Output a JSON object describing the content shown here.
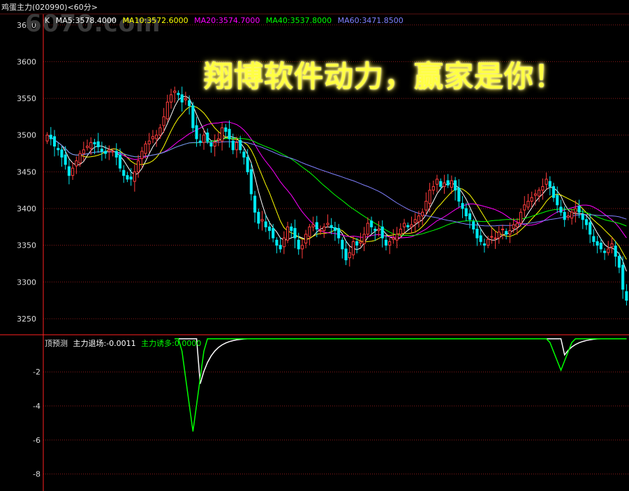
{
  "header": {
    "title": "鸡蛋主力(020990)<60分>",
    "watermark": "6070.com",
    "slogan": "翔博软件动力，赢家是你！"
  },
  "legend": [
    {
      "label": "K",
      "color": "#e0e0e0"
    },
    {
      "label": "MA5:3578.4000",
      "color": "#ffffff"
    },
    {
      "label": "MA10:3572.6000",
      "color": "#ffff00"
    },
    {
      "label": "MA20:3574.7000",
      "color": "#ff00ff"
    },
    {
      "label": "MA40:3537.8000",
      "color": "#00ff00"
    },
    {
      "label": "MA60:3471.8500",
      "color": "#8080ff"
    }
  ],
  "indicator_legend": [
    {
      "label": "顶预测",
      "color": "#e0e0e0"
    },
    {
      "label": "主力退场:-0.0011",
      "color": "#ffffff"
    },
    {
      "label": "主力诱多:0.0000",
      "color": "#00ff00"
    }
  ],
  "colors": {
    "up": "#ff3c3c",
    "down": "#00e8f0",
    "grid": "#8a1a1a",
    "axis": "#ff2020"
  },
  "chart_data": [
    {
      "type": "candlestick",
      "ylim": [
        3230,
        3665
      ],
      "yticks": [
        3650,
        3600,
        3550,
        3500,
        3450,
        3400,
        3350,
        3300,
        3250
      ],
      "close": [
        3500,
        3495,
        3485,
        3480,
        3470,
        3460,
        3445,
        3455,
        3465,
        3475,
        3480,
        3485,
        3490,
        3488,
        3484,
        3478,
        3475,
        3480,
        3478,
        3470,
        3455,
        3445,
        3440,
        3440,
        3450,
        3465,
        3478,
        3488,
        3492,
        3498,
        3500,
        3510,
        3525,
        3545,
        3555,
        3560,
        3555,
        3545,
        3550,
        3540,
        3510,
        3495,
        3490,
        3500,
        3492,
        3485,
        3490,
        3495,
        3510,
        3505,
        3495,
        3480,
        3490,
        3480,
        3470,
        3450,
        3420,
        3395,
        3380,
        3385,
        3375,
        3370,
        3360,
        3350,
        3345,
        3360,
        3375,
        3370,
        3360,
        3345,
        3350,
        3365,
        3375,
        3378,
        3372,
        3370,
        3375,
        3380,
        3374,
        3370,
        3360,
        3345,
        3330,
        3340,
        3355,
        3350,
        3355,
        3365,
        3380,
        3375,
        3370,
        3372,
        3360,
        3350,
        3355,
        3360,
        3365,
        3372,
        3380,
        3375,
        3378,
        3385,
        3390,
        3395,
        3410,
        3425,
        3430,
        3440,
        3430,
        3435,
        3432,
        3438,
        3425,
        3410,
        3400,
        3390,
        3385,
        3372,
        3360,
        3355,
        3350,
        3358,
        3362,
        3360,
        3368,
        3372,
        3365,
        3370,
        3378,
        3380,
        3395,
        3405,
        3410,
        3415,
        3420,
        3425,
        3430,
        3440,
        3430,
        3415,
        3405,
        3395,
        3385,
        3390,
        3395,
        3400,
        3395,
        3385,
        3378,
        3365,
        3355,
        3350,
        3345,
        3340,
        3345,
        3352,
        3335,
        3320,
        3290,
        3275
      ],
      "mas": [
        {
          "period": 5,
          "color": "#ffffff"
        },
        {
          "period": 10,
          "color": "#ffff00"
        },
        {
          "period": 20,
          "color": "#ff00ff"
        },
        {
          "period": 40,
          "color": "#00ff00"
        },
        {
          "period": 60,
          "color": "#8080ff"
        }
      ]
    },
    {
      "type": "line",
      "ylim": [
        -9,
        0.1
      ],
      "yticks": [
        -2,
        -4,
        -6,
        -8
      ],
      "series": [
        {
          "name": "主力退场",
          "color": "#ffffff",
          "spikes": [
            {
              "at": 42,
              "depth": -2.7
            },
            {
              "at": 142,
              "depth": -1.0
            }
          ]
        },
        {
          "name": "主力诱多",
          "color": "#00ff00",
          "spikes": [
            {
              "at": 40,
              "depth": -5.5
            },
            {
              "at": 141,
              "depth": -1.9
            }
          ]
        }
      ]
    }
  ]
}
